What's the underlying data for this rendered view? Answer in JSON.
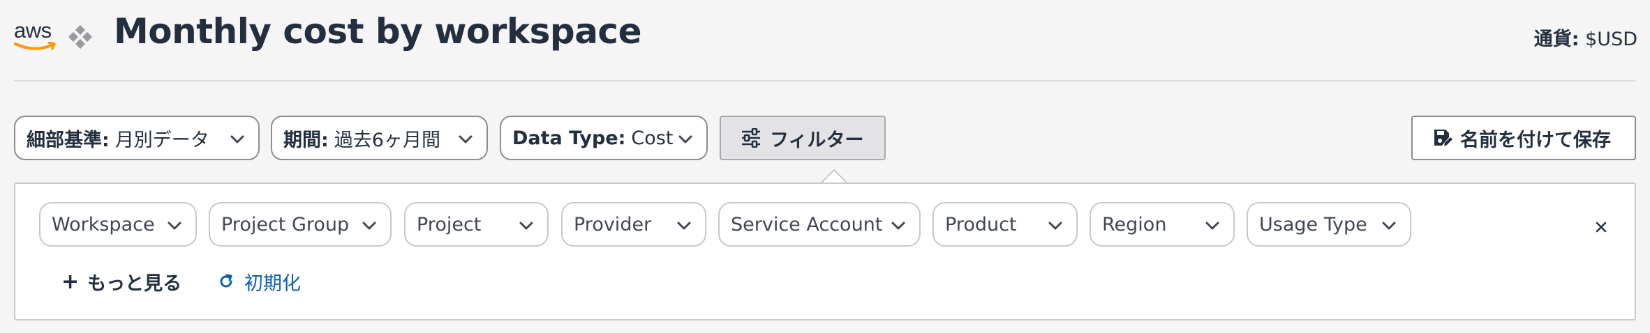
{
  "header": {
    "logo_text": "aws",
    "title": "Monthly cost by workspace",
    "currency_label": "通貨:",
    "currency_value": "$USD"
  },
  "toolbar": {
    "granularity": {
      "label": "細部基準:",
      "value": "月別データ"
    },
    "period": {
      "label": "期間:",
      "value": "過去6ヶ月間"
    },
    "data_type": {
      "label": "Data Type:",
      "value": "Cost"
    },
    "filter_label": "フィルター",
    "save_label": "名前を付けて保存"
  },
  "filter_panel": {
    "chips": [
      {
        "label": "Workspace"
      },
      {
        "label": "Project Group"
      },
      {
        "label": "Project"
      },
      {
        "label": "Provider"
      },
      {
        "label": "Service Account"
      },
      {
        "label": "Product"
      },
      {
        "label": "Region"
      },
      {
        "label": "Usage Type"
      }
    ],
    "more_label": "もっと見る",
    "reset_label": "初期化"
  },
  "icons": [
    "aws-logo-icon",
    "diamond-icon",
    "chevron-down-icon",
    "sliders-icon",
    "save-icon",
    "close-icon",
    "plus-icon",
    "refresh-icon"
  ],
  "colors": {
    "accent_link": "#0b5fb4",
    "title": "#232f3e",
    "aws_orange": "#ff9900"
  }
}
